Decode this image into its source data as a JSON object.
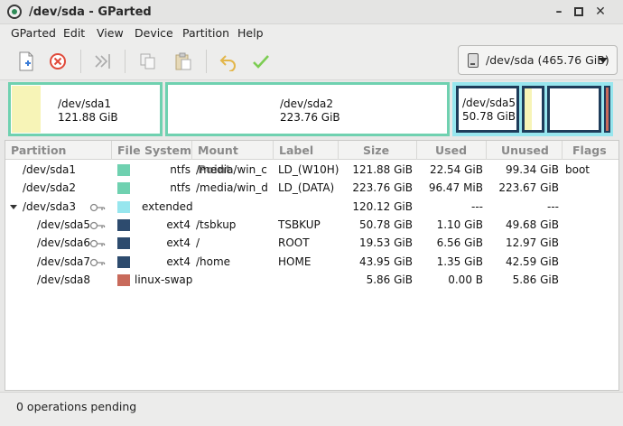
{
  "window": {
    "title": "/dev/sda - GParted",
    "minimize_label": "–",
    "maximize_label": "▫",
    "close_label": "✕"
  },
  "menu": [
    "GParted",
    "Edit",
    "View",
    "Device",
    "Partition",
    "Help"
  ],
  "toolbar": {
    "buttons": [
      "new-icon",
      "delete-icon",
      "resize-move-icon",
      "copy-icon",
      "paste-icon",
      "undo-icon",
      "apply-icon"
    ],
    "device_selector": "/dev/sda (465.76 GiB)"
  },
  "disk_map": [
    {
      "name": "/dev/sda1",
      "size": "121.88 GiB"
    },
    {
      "name": "/dev/sda2",
      "size": "223.76 GiB"
    },
    {
      "name": "/dev/sda5",
      "size": "50.78 GiB"
    }
  ],
  "table": {
    "columns": [
      "Partition",
      "File System",
      "Mount Point",
      "Label",
      "Size",
      "Used",
      "Unused",
      "Flags"
    ],
    "rows": [
      {
        "partition": "/dev/sda1",
        "fs": "ntfs",
        "mount": "/media/win_c",
        "label": "LD_(W10H)",
        "size": "121.88 GiB",
        "used": "22.54 GiB",
        "unused": "99.34 GiB",
        "flags": "boot",
        "color": "#6fd1b0",
        "mounted": false,
        "indent": 0
      },
      {
        "partition": "/dev/sda2",
        "fs": "ntfs",
        "mount": "/media/win_d",
        "label": "LD_(DATA)",
        "size": "223.76 GiB",
        "used": "96.47 MiB",
        "unused": "223.67 GiB",
        "flags": "",
        "color": "#6fd1b0",
        "mounted": false,
        "indent": 0
      },
      {
        "partition": "/dev/sda3",
        "fs": "extended",
        "mount": "",
        "label": "",
        "size": "120.12 GiB",
        "used": "---",
        "unused": "---",
        "flags": "",
        "color": "#97e6ee",
        "mounted": true,
        "indent": 0,
        "expander": true
      },
      {
        "partition": "/dev/sda5",
        "fs": "ext4",
        "mount": "/tsbkup",
        "label": "TSBKUP",
        "size": "50.78 GiB",
        "used": "1.10 GiB",
        "unused": "49.68 GiB",
        "flags": "",
        "color": "#2d4b6e",
        "mounted": true,
        "indent": 1
      },
      {
        "partition": "/dev/sda6",
        "fs": "ext4",
        "mount": "/",
        "label": "ROOT",
        "size": "19.53 GiB",
        "used": "6.56 GiB",
        "unused": "12.97 GiB",
        "flags": "",
        "color": "#2d4b6e",
        "mounted": true,
        "indent": 1
      },
      {
        "partition": "/dev/sda7",
        "fs": "ext4",
        "mount": "/home",
        "label": "HOME",
        "size": "43.95 GiB",
        "used": "1.35 GiB",
        "unused": "42.59 GiB",
        "flags": "",
        "color": "#2d4b6e",
        "mounted": true,
        "indent": 1
      },
      {
        "partition": "/dev/sda8",
        "fs": "linux-swap",
        "mount": "",
        "label": "",
        "size": "5.86 GiB",
        "used": "0.00 B",
        "unused": "5.86 GiB",
        "flags": "",
        "color": "#c86a5b",
        "mounted": false,
        "indent": 1
      }
    ]
  },
  "status": "0 operations pending"
}
